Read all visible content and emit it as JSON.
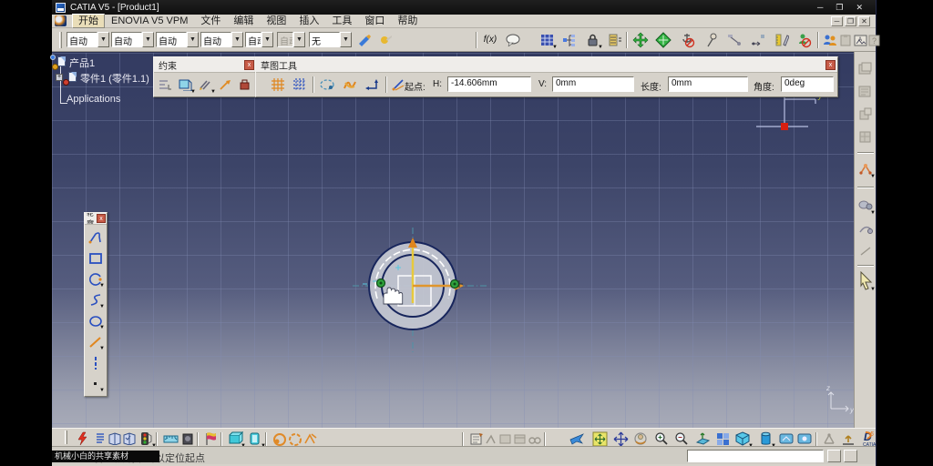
{
  "titlebar": {
    "title": "CATIA V5 - [Product1]",
    "minimize": "─",
    "maximize": "❐",
    "close": "✕"
  },
  "menubar": {
    "items": [
      "开始",
      "ENOVIA V5 VPM",
      "文件",
      "编辑",
      "视图",
      "插入",
      "工具",
      "窗口",
      "帮助"
    ],
    "mdi_minimize": "─",
    "mdi_restore": "❐",
    "mdi_close": "✕"
  },
  "standard_toolbar": {
    "combo_values": [
      "自动",
      "自动",
      "自动",
      "自动",
      "自动",
      "自动",
      "无"
    ],
    "fx_label": "f(x)"
  },
  "tree": {
    "root": "产品1",
    "part": "零件1 (零件1.1)",
    "applications": "Applications"
  },
  "constraints_toolbar": {
    "title": "约束",
    "close": "x"
  },
  "sketch_tools": {
    "title": "草图工具",
    "close": "x",
    "start_label": "起点:",
    "h_label": "H:",
    "h_value": "-14.606mm",
    "v_label": "V:",
    "v_value": "0mm",
    "length_label": "长度:",
    "length_value": "0mm",
    "angle_label": "角度:",
    "angle_value": "0deg"
  },
  "profile_toolbar": {
    "title": "轮廓",
    "close": "x"
  },
  "viewport": {
    "compass": {
      "x": "x",
      "y": "y"
    },
    "axis_indicator": {
      "vertical": "z",
      "horizontal": "y"
    }
  },
  "statusbar": {
    "message": "选择一点或单击以定位起点",
    "caption": "机械小白的共享素材"
  },
  "brand": {
    "logo": "CATIA",
    "logo_number": "5"
  }
}
